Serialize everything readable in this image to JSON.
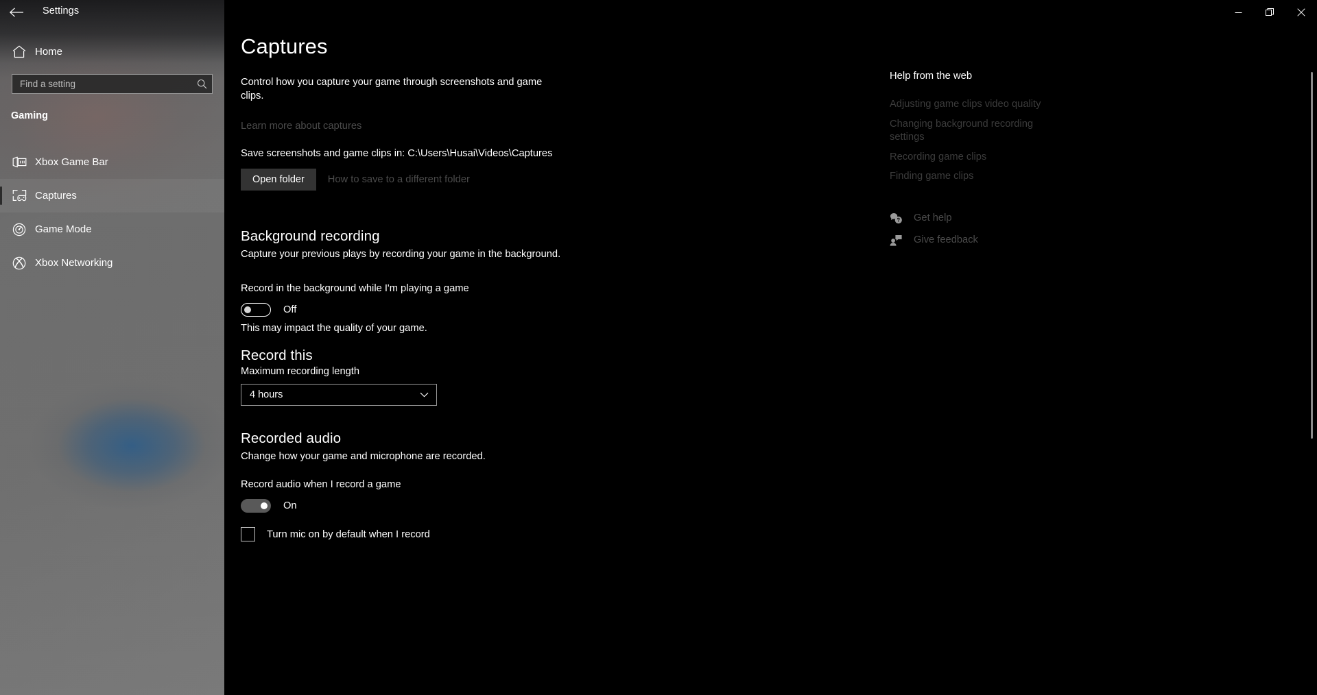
{
  "titlebar": {
    "back_label": "Back",
    "title": "Settings",
    "minimize_label": "Minimize",
    "restore_label": "Restore",
    "close_label": "Close"
  },
  "sidebar": {
    "home_label": "Home",
    "search": {
      "placeholder": "Find a setting",
      "value": ""
    },
    "category": "Gaming",
    "items": [
      {
        "label": "Xbox Game Bar",
        "icon": "game-bar-icon",
        "selected": false
      },
      {
        "label": "Captures",
        "icon": "captures-icon",
        "selected": true
      },
      {
        "label": "Game Mode",
        "icon": "game-mode-icon",
        "selected": false
      },
      {
        "label": "Xbox Networking",
        "icon": "xbox-icon",
        "selected": false
      }
    ]
  },
  "main": {
    "page_title": "Captures",
    "intro": "Control how you capture your game through screenshots and game clips.",
    "learn_more_link": "Learn more about captures",
    "save_path_text": "Save screenshots and game clips in: C:\\Users\\Husai\\Videos\\Captures",
    "open_folder_button": "Open folder",
    "different_folder_link": "How to save to a different folder",
    "background_recording": {
      "heading": "Background recording",
      "subtext": "Capture your previous plays by recording your game in the background.",
      "toggle_label": "Record in the background while I'm playing a game",
      "toggle_state": "Off",
      "toggle_on": false,
      "note": "This may impact the quality of your game."
    },
    "record_this": {
      "heading": "Record this",
      "field_label": "Maximum recording length",
      "selected_value": "4 hours"
    },
    "recorded_audio": {
      "heading": "Recorded audio",
      "subtext": "Change how your game and microphone are recorded.",
      "toggle_label": "Record audio when I record a game",
      "toggle_state": "On",
      "toggle_on": true,
      "checkbox_label": "Turn mic on by default when I record",
      "checkbox_checked": false
    }
  },
  "help": {
    "title": "Help from the web",
    "links": [
      "Adjusting game clips video quality",
      "Changing background recording settings",
      "Recording game clips",
      "Finding game clips"
    ],
    "actions": [
      {
        "label": "Get help",
        "icon": "help-bubble-icon"
      },
      {
        "label": "Give feedback",
        "icon": "feedback-person-icon"
      }
    ]
  },
  "colors": {
    "page_background": "#000000",
    "sidebar_background": "#6a6a6a",
    "text_primary": "#ffffff",
    "text_disabled": "#4b4b4b",
    "button_background": "#333333",
    "toggle_on_track": "#595959",
    "scrollbar_thumb": "#8a8a8a"
  }
}
